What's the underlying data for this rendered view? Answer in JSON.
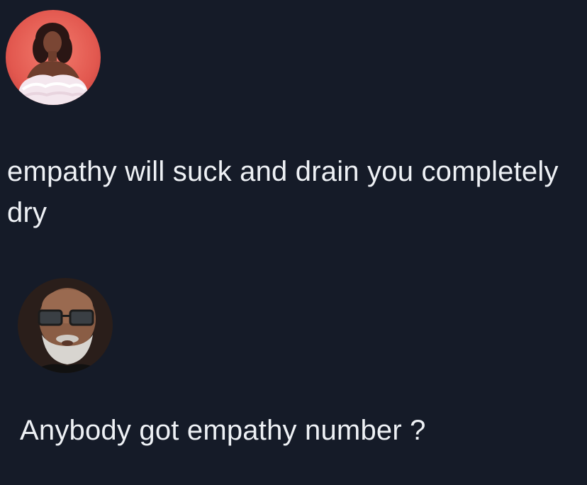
{
  "posts": [
    {
      "avatar_icon": "profile-photo-woman",
      "text": "empathy will suck and drain you completely dry"
    },
    {
      "avatar_icon": "profile-photo-man",
      "text": "Anybody got empathy number ?"
    }
  ],
  "colors": {
    "background": "#151b28",
    "text": "#eef1f5"
  }
}
